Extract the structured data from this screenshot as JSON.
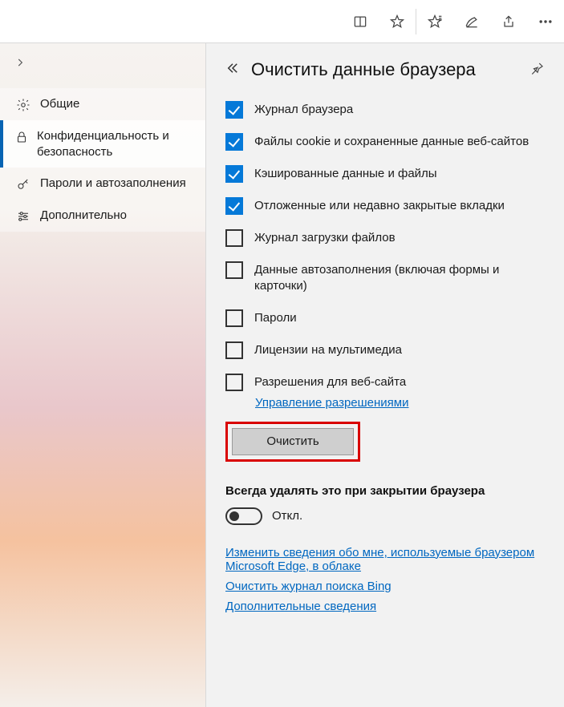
{
  "sidebar": {
    "items": [
      {
        "label": "Общие"
      },
      {
        "label": "Конфиденциальность и безопасность"
      },
      {
        "label": "Пароли и автозаполнения"
      },
      {
        "label": "Дополнительно"
      }
    ]
  },
  "panel": {
    "title": "Очистить данные браузера",
    "checks": [
      {
        "label": "Журнал браузера",
        "checked": true
      },
      {
        "label": "Файлы cookie и сохраненные данные веб-сайтов",
        "checked": true
      },
      {
        "label": "Кэшированные данные и файлы",
        "checked": true
      },
      {
        "label": "Отложенные или недавно закрытые вкладки",
        "checked": true
      },
      {
        "label": "Журнал загрузки файлов",
        "checked": false
      },
      {
        "label": "Данные автозаполнения (включая формы и карточки)",
        "checked": false
      },
      {
        "label": "Пароли",
        "checked": false
      },
      {
        "label": "Лицензии на мультимедиа",
        "checked": false
      },
      {
        "label": "Разрешения для веб-сайта",
        "checked": false
      }
    ],
    "permissions_link": "Управление разрешениями",
    "clear_button": "Очистить",
    "always_heading": "Всегда удалять это при закрытии браузера",
    "toggle_label": "Откл.",
    "links": [
      "Изменить сведения обо мне, используемые браузером Microsoft Edge, в облаке",
      "Очистить журнал поиска Bing",
      "Дополнительные сведения"
    ]
  }
}
